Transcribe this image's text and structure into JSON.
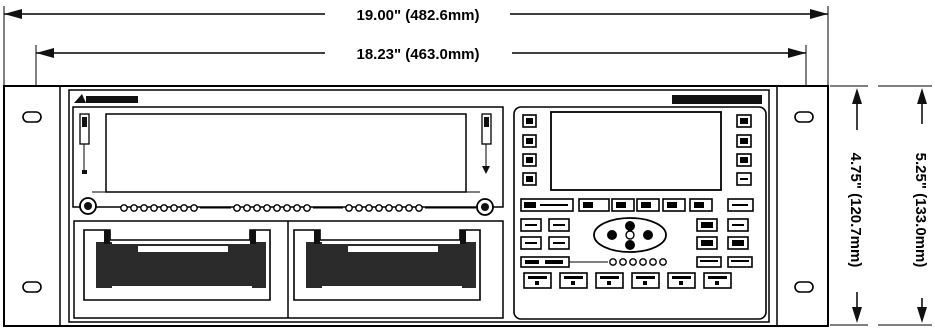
{
  "dimensions": {
    "overall_width": "19.00\" (482.6mm)",
    "panel_width": "18.23\" (463.0mm)",
    "inner_height": "4.75\" (120.7mm)",
    "overall_height": "5.25\" (133.0mm)"
  },
  "colors": {
    "ink": "#000000",
    "paper": "#ffffff"
  },
  "icons": {
    "logo": "brand-logo-mark",
    "mount_holes": "oval-mount-hole",
    "connectors": "d-sub-connector"
  }
}
